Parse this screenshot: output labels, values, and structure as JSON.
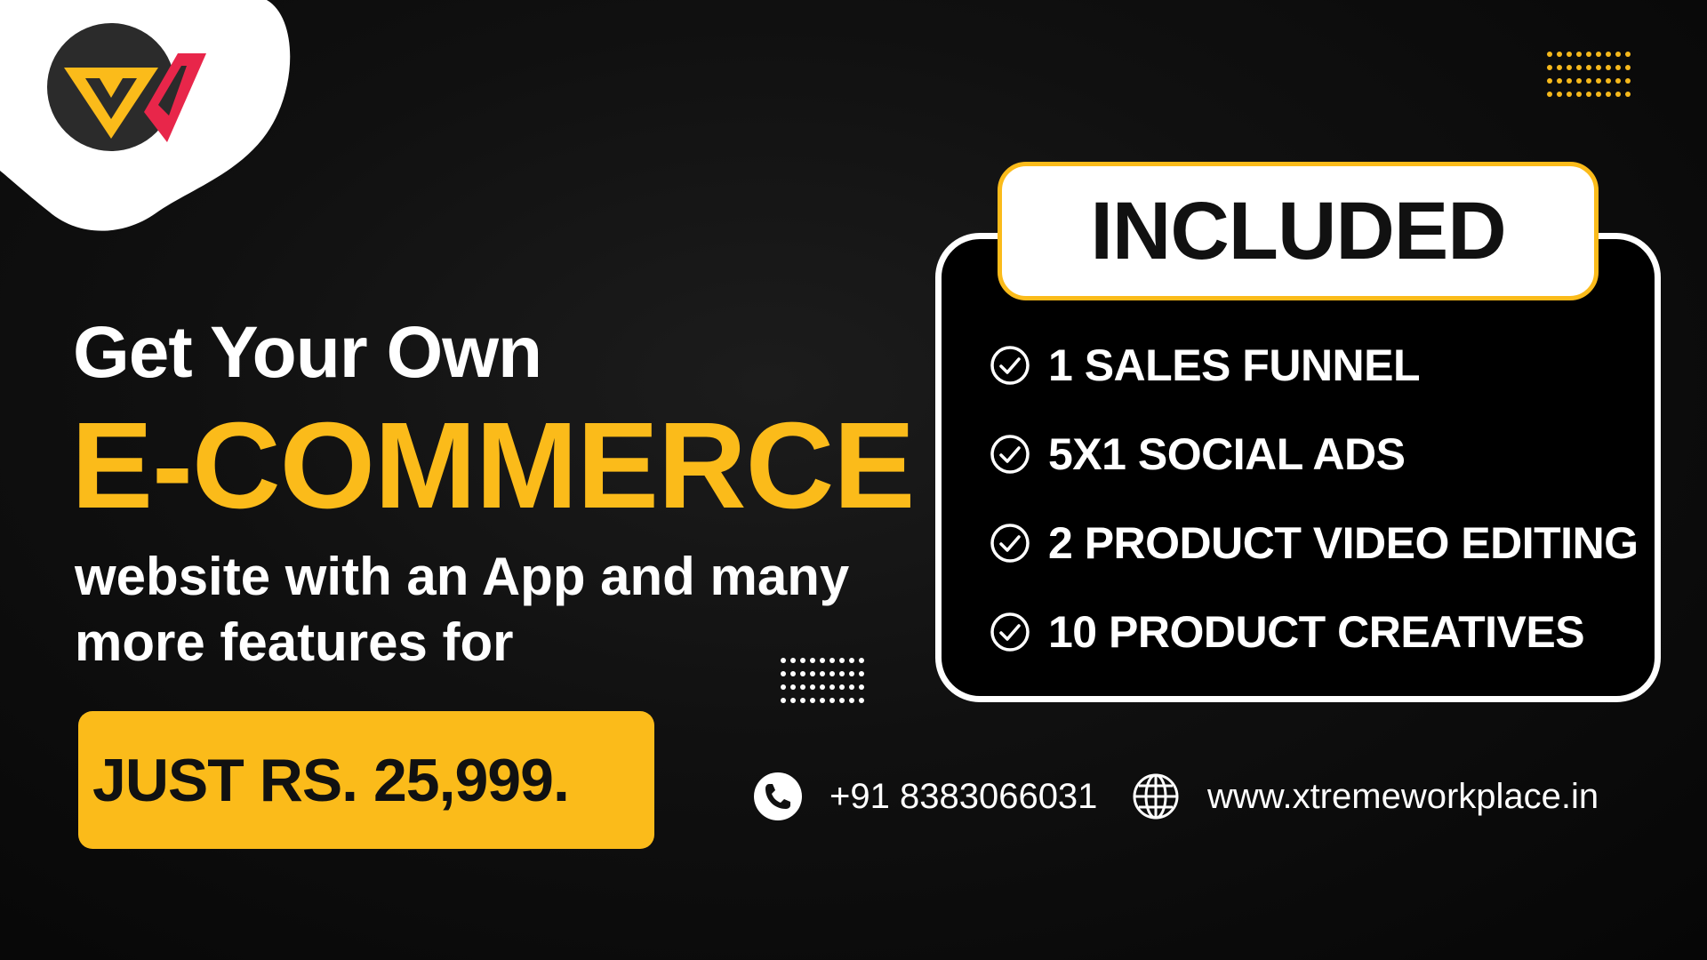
{
  "brand": {
    "logo_icon": "xw-logo-icon",
    "colors": {
      "accent": "#fbbb1a",
      "secondary_accent": "#e8264a",
      "background": "#0b0b0b",
      "text": "#ffffff"
    }
  },
  "headline": {
    "line1": "Get Your Own",
    "line2": "E-COMMERCE",
    "line3": "website with an App and many more features for"
  },
  "price": {
    "label": "JUST RS. 25,999."
  },
  "included": {
    "title": "INCLUDED",
    "check_icon": "check-circle-icon",
    "items": [
      {
        "label": "1 SALES FUNNEL"
      },
      {
        "label": "5X1 SOCIAL ADS"
      },
      {
        "label": "2 PRODUCT VIDEO EDITING"
      },
      {
        "label": "10 PRODUCT CREATIVES"
      }
    ]
  },
  "contact": {
    "phone_icon": "phone-icon",
    "phone": "+91 8383066031",
    "web_icon": "globe-icon",
    "website": "www.xtremeworkplace.in"
  }
}
